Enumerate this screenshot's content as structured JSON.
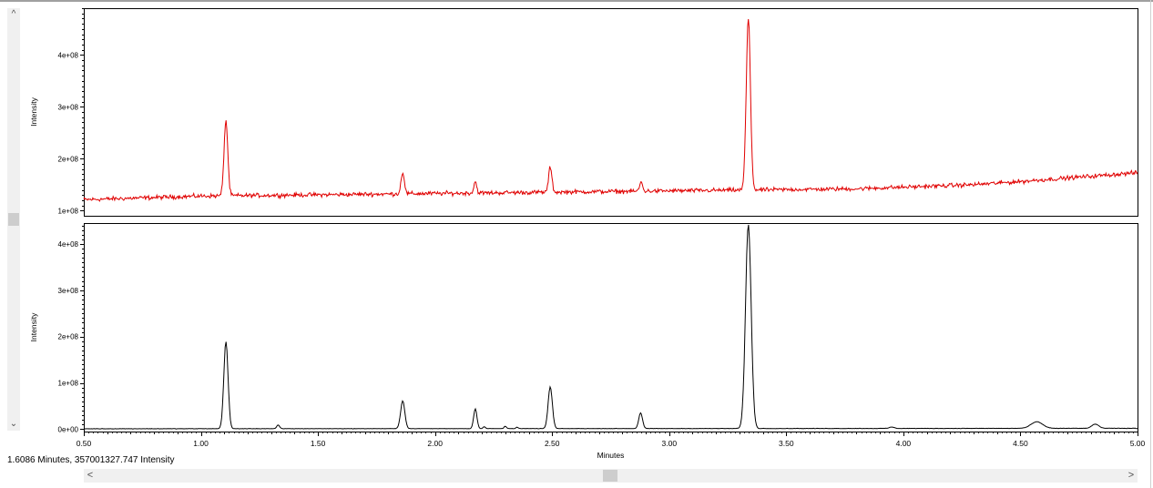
{
  "status_text": "1.6086 Minutes, 357001327.747 Intensity",
  "scrollbar_glyphs": {
    "up": "^",
    "down": "⌄",
    "left": "<",
    "right": ">"
  },
  "chart_data": [
    {
      "type": "line",
      "title": "",
      "xlabel": "",
      "ylabel": "Intensity",
      "xlim": [
        0.5,
        5.0
      ],
      "ylim": [
        90000000,
        490000000
      ],
      "yticks": [
        100000000,
        200000000,
        300000000,
        400000000
      ],
      "ytick_labels": [
        "1e+08",
        "2e+08",
        "3e+08",
        "4e+08"
      ],
      "color": "#e00000",
      "noisy": true,
      "baseline": [
        [
          0.5,
          121000000
        ],
        [
          1.0,
          128000000
        ],
        [
          2.0,
          133000000
        ],
        [
          3.0,
          138000000
        ],
        [
          3.8,
          142000000
        ],
        [
          4.3,
          150000000
        ],
        [
          4.5,
          156000000
        ],
        [
          5.0,
          173000000
        ]
      ],
      "peaks": [
        {
          "x": 1.107,
          "height": 145000000,
          "width": 0.008
        },
        {
          "x": 1.862,
          "height": 42000000,
          "width": 0.007
        },
        {
          "x": 2.172,
          "height": 22000000,
          "width": 0.006
        },
        {
          "x": 2.492,
          "height": 48000000,
          "width": 0.007
        },
        {
          "x": 2.88,
          "height": 18000000,
          "width": 0.006
        },
        {
          "x": 3.338,
          "height": 330000000,
          "width": 0.009
        }
      ]
    },
    {
      "type": "line",
      "title": "",
      "xlabel": "Minutes",
      "ylabel": "Intensity",
      "xlim": [
        0.5,
        5.0
      ],
      "ylim": [
        -5000000,
        445000000
      ],
      "xticks": [
        0.5,
        1.0,
        1.5,
        2.0,
        2.5,
        3.0,
        3.5,
        4.0,
        4.5,
        5.0
      ],
      "xtick_labels": [
        "0.50",
        "1.00",
        "1.50",
        "2.00",
        "2.50",
        "3.00",
        "3.50",
        "4.00",
        "4.50",
        "5.00"
      ],
      "yticks": [
        0,
        100000000,
        200000000,
        300000000,
        400000000
      ],
      "ytick_labels": [
        "0e+00",
        "1e+08",
        "2e+08",
        "3e+08",
        "4e+08"
      ],
      "color": "#000000",
      "noisy": false,
      "baseline": [
        [
          0.5,
          1000000
        ],
        [
          5.0,
          2000000
        ]
      ],
      "peaks": [
        {
          "x": 1.107,
          "height": 188000000,
          "width": 0.009
        },
        {
          "x": 1.33,
          "height": 8000000,
          "width": 0.006
        },
        {
          "x": 1.862,
          "height": 60000000,
          "width": 0.009
        },
        {
          "x": 2.172,
          "height": 43000000,
          "width": 0.007
        },
        {
          "x": 2.21,
          "height": 4000000,
          "width": 0.005
        },
        {
          "x": 2.3,
          "height": 5000000,
          "width": 0.005
        },
        {
          "x": 2.35,
          "height": 3000000,
          "width": 0.005
        },
        {
          "x": 2.492,
          "height": 90000000,
          "width": 0.009
        },
        {
          "x": 2.878,
          "height": 34000000,
          "width": 0.008
        },
        {
          "x": 3.338,
          "height": 440000000,
          "width": 0.012
        },
        {
          "x": 3.95,
          "height": 3000000,
          "width": 0.01
        },
        {
          "x": 4.57,
          "height": 14000000,
          "width": 0.025
        },
        {
          "x": 4.82,
          "height": 9000000,
          "width": 0.015
        }
      ]
    }
  ]
}
